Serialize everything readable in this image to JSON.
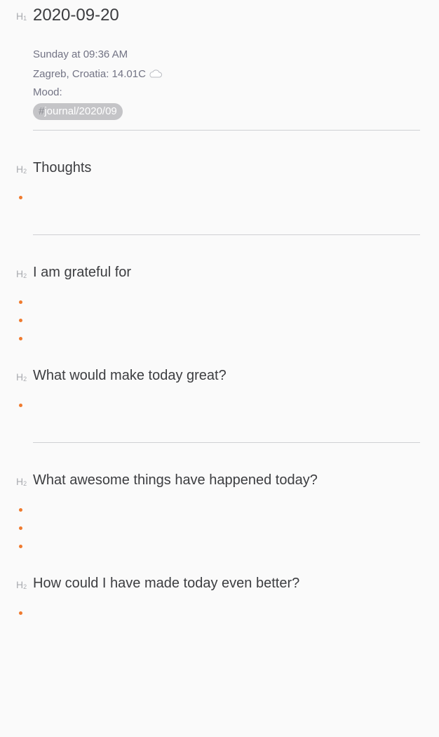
{
  "heading1": {
    "marker": "H",
    "marker_level": "1",
    "title": "2020-09-20"
  },
  "meta": {
    "datetime": "Sunday at 09:36 AM",
    "location_weather": "Zagreb, Croatia: 14.01C",
    "weather_icon": "cloud-icon",
    "mood": "Mood:"
  },
  "tag": {
    "hash": "#",
    "label": "journal/2020/09"
  },
  "sections": [
    {
      "marker": "H",
      "marker_level": "2",
      "title": "Thoughts",
      "bullets": 1
    },
    {
      "marker": "H",
      "marker_level": "2",
      "title": "I am grateful for",
      "bullets": 3
    },
    {
      "marker": "H",
      "marker_level": "2",
      "title": "What would make today great?",
      "bullets": 1
    },
    {
      "marker": "H",
      "marker_level": "2",
      "title": "What awesome things have happened today?",
      "bullets": 3
    },
    {
      "marker": "H",
      "marker_level": "2",
      "title": "How could I have made today even better?",
      "bullets": 1
    }
  ],
  "colors": {
    "background": "#fafafa",
    "text": "#3c3d40",
    "meta_text": "#727384",
    "heading_marker": "#a9abb0",
    "bullet": "#ef7a2e",
    "tag_background": "#c4c4c7",
    "rule": "#cfd0d3"
  }
}
